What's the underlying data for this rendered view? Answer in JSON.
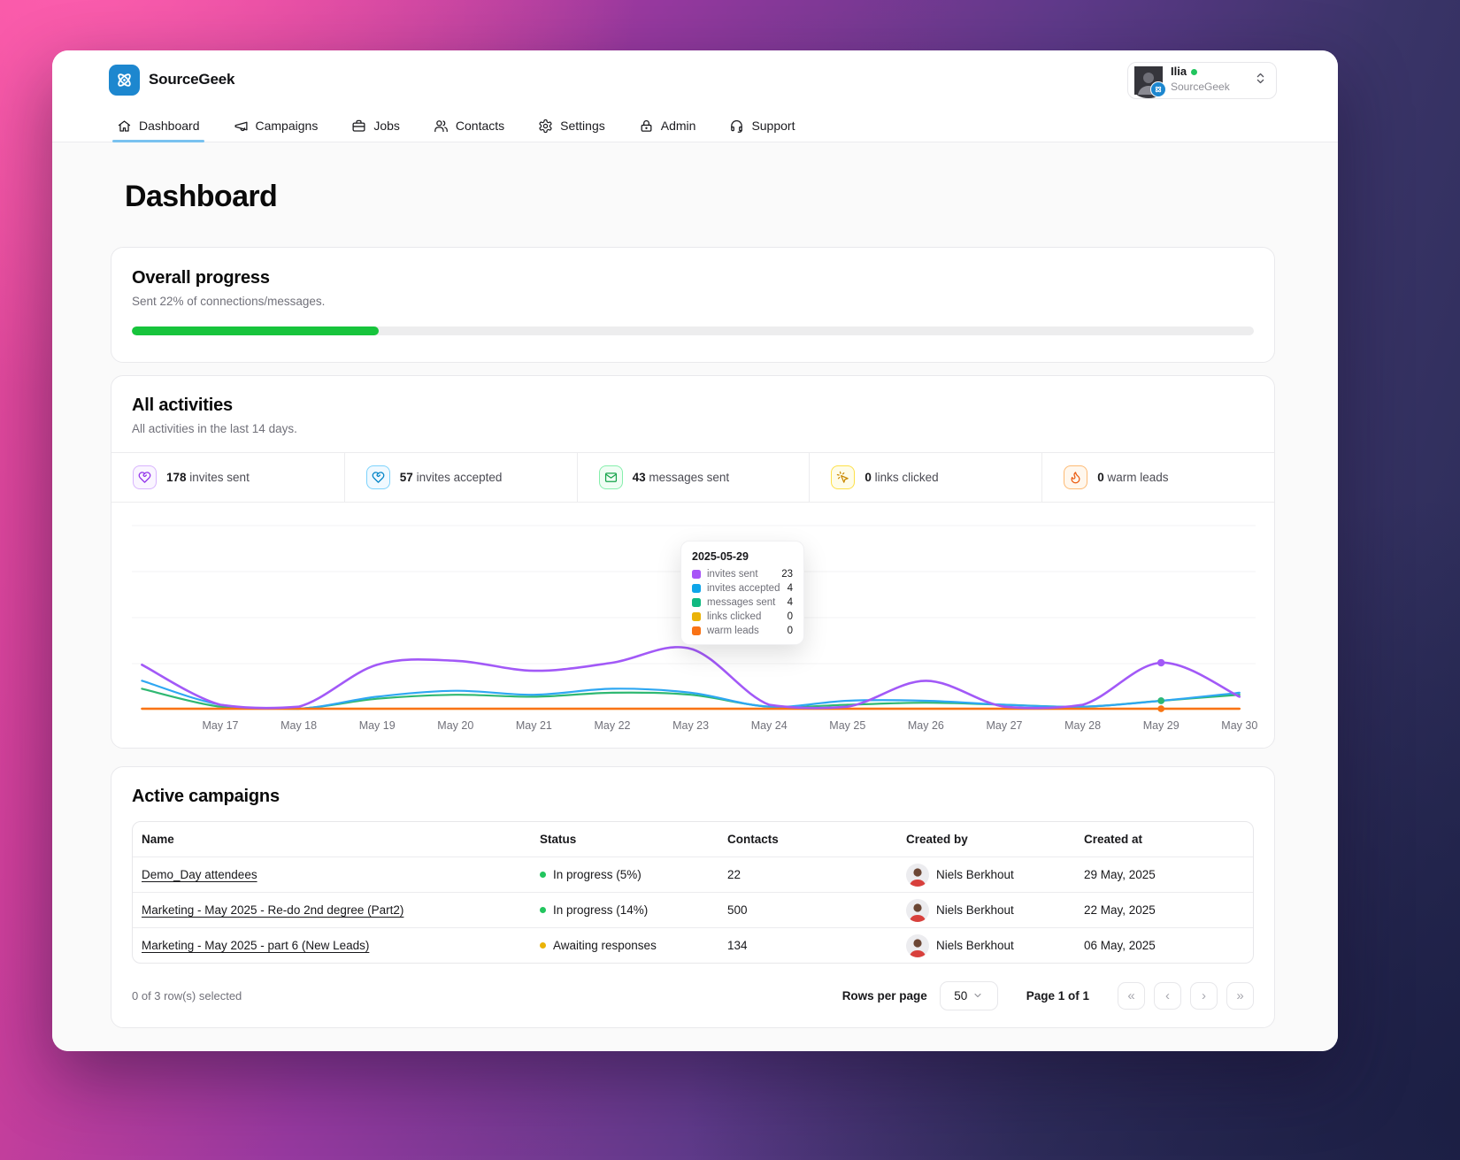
{
  "brand": {
    "name": "SourceGeek",
    "logo_color": "#1d87cf"
  },
  "user_menu": {
    "name": "Ilia",
    "org": "SourceGeek",
    "presence_color": "#22c55e"
  },
  "nav": {
    "items": [
      {
        "label": "Dashboard",
        "active": true
      },
      {
        "label": "Campaigns",
        "active": false
      },
      {
        "label": "Jobs",
        "active": false
      },
      {
        "label": "Contacts",
        "active": false
      },
      {
        "label": "Settings",
        "active": false
      },
      {
        "label": "Admin",
        "active": false
      },
      {
        "label": "Support",
        "active": false
      }
    ]
  },
  "page": {
    "title": "Dashboard"
  },
  "overall_progress": {
    "title": "Overall progress",
    "subtitle": "Sent 22% of connections/messages.",
    "percent": 22,
    "bar_color": "#17c43c",
    "fill_width": "22%"
  },
  "activities": {
    "title": "All activities",
    "subtitle": "All activities in the last 14 days.",
    "stats": [
      {
        "value": "178",
        "label": " invites sent",
        "color": "#9333ea",
        "border": "#d8b4fe",
        "bg": "#faf5ff"
      },
      {
        "value": "57",
        "label": " invites accepted",
        "color": "#0284c7",
        "border": "#7dd3fc",
        "bg": "#f0f9ff"
      },
      {
        "value": "43",
        "label": " messages sent",
        "color": "#16a34a",
        "border": "#86efac",
        "bg": "#f0fdf4"
      },
      {
        "value": "0",
        "label": " links clicked",
        "color": "#ca8a04",
        "border": "#fde047",
        "bg": "#fefce8"
      },
      {
        "value": "0",
        "label": " warm leads",
        "color": "#ea580c",
        "border": "#fdba74",
        "bg": "#fff7ed"
      }
    ],
    "tooltip": {
      "date": "2025-05-29",
      "rows": [
        {
          "label": "invites sent",
          "value": "23",
          "color": "#a855f7"
        },
        {
          "label": "invites accepted",
          "value": "4",
          "color": "#0ea5e9"
        },
        {
          "label": "messages sent",
          "value": "4",
          "color": "#10b981"
        },
        {
          "label": "links clicked",
          "value": "0",
          "color": "#eab308"
        },
        {
          "label": "warm leads",
          "value": "0",
          "color": "#f97316"
        }
      ]
    }
  },
  "chart_data": {
    "type": "line",
    "title": "All activities (last 14 days)",
    "x_labels": [
      "",
      "May 17",
      "May 18",
      "May 19",
      "May 20",
      "May 21",
      "May 22",
      "May 23",
      "May 24",
      "May 25",
      "May 26",
      "May 27",
      "May 28",
      "May 29",
      "May 30"
    ],
    "series": [
      {
        "name": "invites sent",
        "color": "#a259f7",
        "values": [
          22,
          2,
          1,
          22,
          24,
          19,
          23,
          30,
          2,
          1,
          14,
          1,
          2,
          23,
          6
        ]
      },
      {
        "name": "invites accepted",
        "color": "#2ea7f2",
        "values": [
          14,
          2,
          0,
          6,
          9,
          7,
          10,
          8,
          1,
          4,
          4,
          2,
          1,
          4,
          8
        ]
      },
      {
        "name": "messages sent",
        "color": "#2fb872",
        "values": [
          10,
          1,
          0,
          5,
          7,
          6,
          8,
          7,
          1,
          2,
          3,
          2,
          1,
          4,
          7
        ]
      },
      {
        "name": "links clicked",
        "color": "#eab308",
        "values": [
          0,
          0,
          0,
          0,
          0,
          0,
          0,
          0,
          0,
          0,
          0,
          0,
          0,
          0,
          0
        ]
      },
      {
        "name": "warm leads",
        "color": "#f97316",
        "values": [
          0,
          0,
          0,
          0,
          0,
          0,
          0,
          0,
          0,
          0,
          0,
          0,
          0,
          0,
          0
        ]
      }
    ],
    "marker_index": 13,
    "y_axis_visible": false,
    "ylim": [
      0,
      35
    ],
    "grid": true
  },
  "campaigns": {
    "title": "Active campaigns",
    "columns": [
      "Name",
      "Status",
      "Contacts",
      "Created by",
      "Created at"
    ],
    "rows": [
      {
        "name": "Demo_Day attendees",
        "status": "In progress (5%)",
        "status_color": "#22c55e",
        "contacts": "22",
        "created_by": "Niels Berkhout",
        "created_at": "29 May, 2025"
      },
      {
        "name": "Marketing - May 2025 - Re-do 2nd degree (Part2)",
        "status": "In progress (14%)",
        "status_color": "#22c55e",
        "contacts": "500",
        "created_by": "Niels Berkhout",
        "created_at": "22 May, 2025"
      },
      {
        "name": "Marketing - May 2025 - part 6 (New Leads)",
        "status": "Awaiting responses",
        "status_color": "#eab308",
        "contacts": "134",
        "created_by": "Niels Berkhout",
        "created_at": "06 May, 2025"
      }
    ],
    "footer": {
      "selected": "0 of 3 row(s) selected",
      "rows_per_page_label": "Rows per page",
      "rows_per_page": "50",
      "page": "Page 1 of 1",
      "pager": [
        "«",
        "‹",
        "›",
        "»"
      ]
    }
  }
}
